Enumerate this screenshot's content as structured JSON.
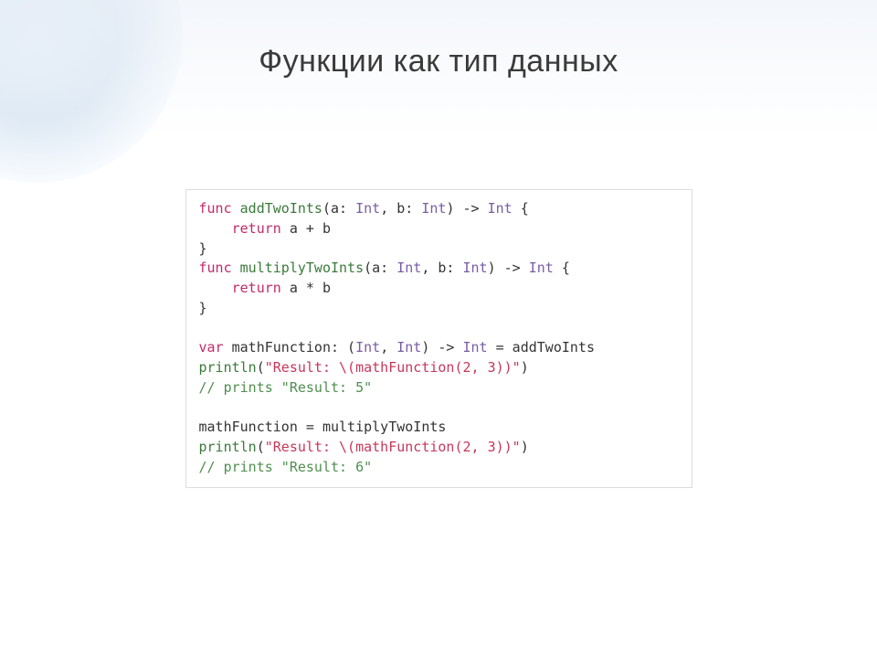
{
  "slide": {
    "title": "Функции как тип данных"
  },
  "code": {
    "lines": [
      {
        "t": "func",
        "c": "kw"
      },
      {
        "t": " ",
        "c": ""
      },
      {
        "t": "addTwoInts",
        "c": "fn"
      },
      {
        "t": "(a: ",
        "c": ""
      },
      {
        "t": "Int",
        "c": "type"
      },
      {
        "t": ", b: ",
        "c": ""
      },
      {
        "t": "Int",
        "c": "type"
      },
      {
        "t": ") -> ",
        "c": ""
      },
      {
        "t": "Int",
        "c": "type"
      },
      {
        "t": " {",
        "c": ""
      }
    ],
    "l1_indent": "    ",
    "l1_return": "return",
    "l1_expr": " a + b",
    "l2_brace": "}",
    "l3_func": "func",
    "l3_name": "multiplyTwoInts",
    "l3_sig1": "(a: ",
    "l3_int1": "Int",
    "l3_sig2": ", b: ",
    "l3_int2": "Int",
    "l3_sig3": ") -> ",
    "l3_int3": "Int",
    "l3_brace": " {",
    "l4_indent": "    ",
    "l4_return": "return",
    "l4_expr": " a * b",
    "l5_brace": "}",
    "l6_empty": "",
    "l7_var": "var",
    "l7_name": " mathFunction: (",
    "l7_int1": "Int",
    "l7_comma": ", ",
    "l7_int2": "Int",
    "l7_arrow": ") -> ",
    "l7_int3": "Int",
    "l7_eq": " = addTwoInts",
    "l8_fn": "println",
    "l8_paren": "(",
    "l8_str": "\"Result: \\(mathFunction(2, 3))\"",
    "l8_close": ")",
    "l9_comment": "// prints \"Result: 5\"",
    "l10_empty": "",
    "l11_assign": "mathFunction = multiplyTwoInts",
    "l12_fn": "println",
    "l12_paren": "(",
    "l12_str": "\"Result: \\(mathFunction(2, 3))\"",
    "l12_close": ")",
    "l13_comment": "// prints \"Result: 6\""
  }
}
